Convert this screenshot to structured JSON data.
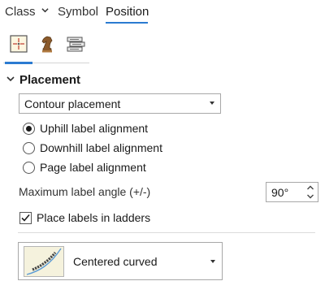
{
  "tabs": {
    "class_label": "Class",
    "symbol_label": "Symbol",
    "position_label": "Position",
    "active_tab": "Position"
  },
  "subtabs": {
    "items": [
      "placement-frame-icon",
      "chess-knight-icon",
      "stacked-labels-icon"
    ],
    "active_index": 0
  },
  "placement": {
    "header": "Placement",
    "placement_dropdown_value": "Contour placement",
    "radios": [
      {
        "label": "Uphill label alignment",
        "checked": true
      },
      {
        "label": "Downhill label alignment",
        "checked": false
      },
      {
        "label": "Page label alignment",
        "checked": false
      }
    ],
    "max_angle_label": "Maximum label angle (+/-)",
    "max_angle_value": "90°",
    "ladders_label": "Place labels in ladders",
    "ladders_checked": true,
    "style_dropdown_value": "Centered curved"
  },
  "colors": {
    "accent": "#2b7bd1",
    "thumb_bg": "#f5f2dd",
    "thumb_line": "#5b9bd5"
  }
}
